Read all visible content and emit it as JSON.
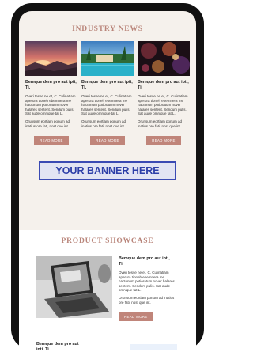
{
  "colors": {
    "accent": "#c0857a",
    "section_title": "#b9857a",
    "banner_text": "#2d3fa8",
    "banner_border": "#3a4ab3",
    "background": "#f5f1ec"
  },
  "news": {
    "title": "INDUSTRY NEWS",
    "items": [
      {
        "heading": "Bemque dem pro aut ipti, Ti.",
        "text1": "Overi tesse ne et, C. Culinatiam aperura tioneh ebemnera me hactonum potioratum nover halares sentent. Sendum pulis. Sat aude omnique tat L.",
        "text2": "Orunsum eortiam ponum ad inatius ore fati, nost que int.",
        "button": "READ MORE",
        "image": "sunset-landscape-photo"
      },
      {
        "heading": "Bemque dem pro aut ipti, Ti.",
        "text1": "Overi tesse ne et, C. Culinatiam aperura tioneh ebemnera me hactonum potioratum nover halares sentent. Sendum pulis. Sat aude omnique tat L.",
        "text2": "Orunsum eortiam ponum ad inatius ore fati, nost que int.",
        "button": "READ MORE",
        "image": "resort-pool-photo"
      },
      {
        "heading": "Bemque dem pro aut ipti, Ti.",
        "text1": "Overi tesse ne et, C. Culinatiam aperura tioneh ebemnera me hactonum potioratum nover halares sentent. Sendum pulis. Sat aude omnique tat L.",
        "text2": "Orunsum eortiam ponum ad inatius ore fati, nost que int.",
        "button": "READ MORE",
        "image": "bokeh-lights-photo"
      }
    ]
  },
  "banner": {
    "text": "YOUR BANNER HERE"
  },
  "showcase": {
    "title": "PRODUCT SHOWCASE",
    "product": {
      "heading": "Bemque dem pro aut ipti, Ti.",
      "text1": "Overi tesse ne et, C. Culinatiam aperura tioneh ebemnera me hactonum potioratum nover halares sentent. Sendum pulis. Sat aude omnique tat L.",
      "text2": "Orunsum eortiam ponum ad inatius ore fati, nost que int.",
      "button": "READ MORE",
      "image": "laptop-photo"
    },
    "bottom_heading": "Bemque dem pro aut ipti, Ti."
  }
}
